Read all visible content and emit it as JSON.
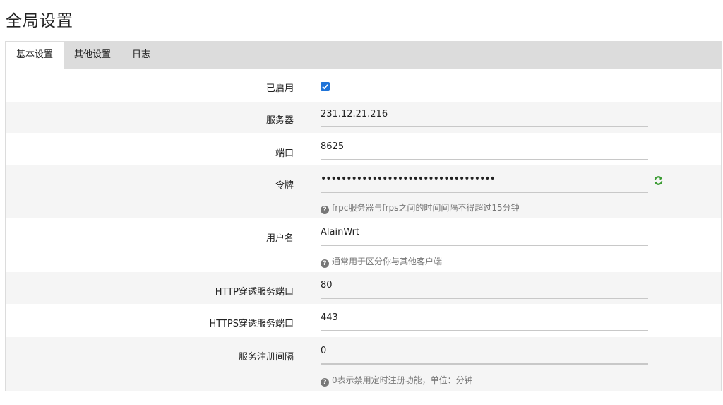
{
  "page": {
    "title": "全局设置"
  },
  "tabs": [
    {
      "label": "基本设置",
      "active": true
    },
    {
      "label": "其他设置",
      "active": false
    },
    {
      "label": "日志",
      "active": false
    }
  ],
  "form": {
    "enabled": {
      "label": "已启用",
      "checked": true
    },
    "server": {
      "label": "服务器",
      "value": "231.12.21.216"
    },
    "port": {
      "label": "端口",
      "value": "8625"
    },
    "token": {
      "label": "令牌",
      "value": "••••••••••••••••••••••••••••••••••",
      "help": "frpc服务器与frps之间的时间间隔不得超过15分钟"
    },
    "username": {
      "label": "用户名",
      "value": "AlainWrt",
      "help": "通常用于区分你与其他客户端"
    },
    "http_port": {
      "label": "HTTP穿透服务端口",
      "value": "80"
    },
    "https_port": {
      "label": "HTTPS穿透服务端口",
      "value": "443"
    },
    "register_interval": {
      "label": "服务注册间隔",
      "value": "0",
      "help": "0表示禁用定时注册功能，单位：分钟"
    }
  },
  "icons": {
    "help": "question-circle-icon",
    "refresh": "refresh-icon",
    "checkbox_color": "#1e73d8",
    "refresh_color": "#3a9b32"
  }
}
